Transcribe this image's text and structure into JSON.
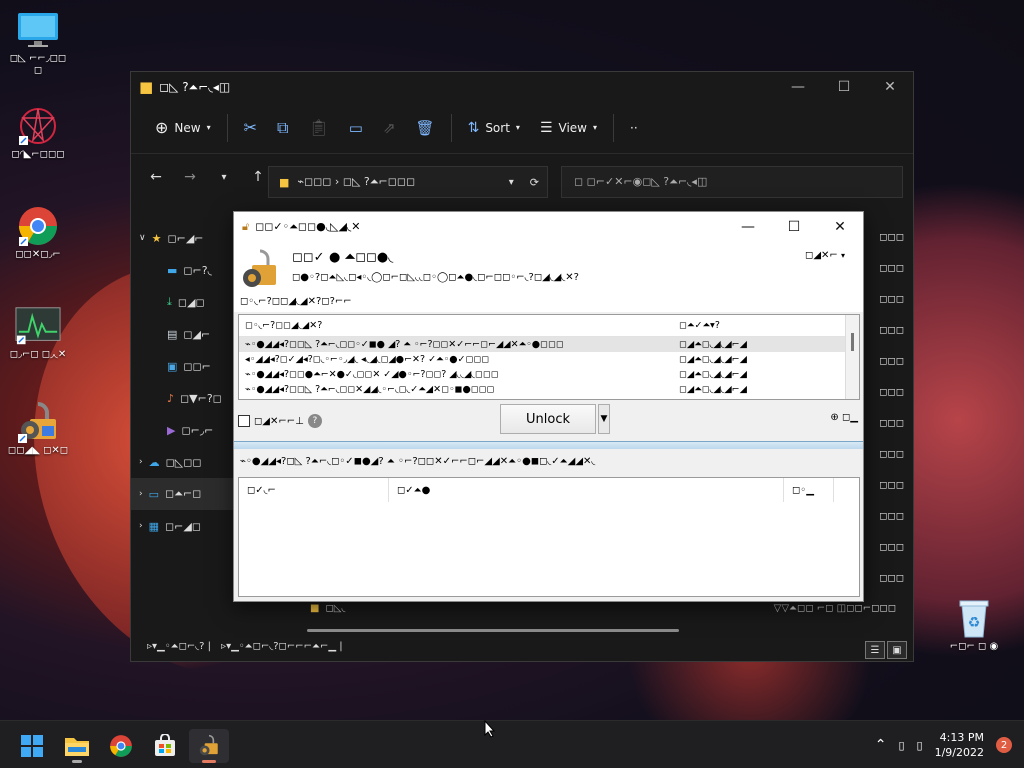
{
  "desktop": {
    "icons": [
      {
        "label": "◻◺ ⌐⌐◞◻◻◻"
      },
      {
        "label": "◻◜◣⌐◻◻◻"
      },
      {
        "label": "◻◻✕◻◞⌐"
      },
      {
        "label": "◻◞⌐◻ ◻◞◟✕"
      },
      {
        "label": "◻◻◢◣ ◻✕◻"
      },
      {
        "label": "⌐◻⌐ ◻ ◉"
      }
    ]
  },
  "explorer": {
    "title": "◻◺ ?⏶⌐◟◂◫",
    "toolbar": {
      "new_label": "New",
      "sort_label": "Sort",
      "view_label": "View",
      "more_label": "··"
    },
    "address": "⌁◻◻◻ › ◻◺ ?⏶⌐◻◻◻",
    "search_placeholder": "◻ ◻⌐✓✕⌐◉◻◺ ?⏶⌐◟◂◫",
    "nav_items": [
      "◻⌐◢⌐",
      "◻⌐?◟",
      "◻◢◻",
      "◻◢⌐",
      "◻◻⌐",
      "◻▼⌐?◻",
      "◻⌐◞⌐",
      "◻◺◻◻",
      "◻⏶⌐◻",
      "◻⌐◢◻"
    ],
    "right_col": [
      "◻◻◻",
      "◻◻◻",
      "◻◻◻",
      "◻◻◻",
      "◻◻◻",
      "◻◻◻",
      "◻◻◻",
      "◻◻◻",
      "◻◻◻",
      "◻◻◻",
      "◻◻◻",
      "◻◻◻"
    ],
    "folder_row": {
      "name": "◻◺◟",
      "info": "▽▽⏶◻◻ ⌐◻ ◫◻◻⌐◻◻◻"
    },
    "status_left": "▹▾▁◦⏶◻⌐◟? |",
    "status_right": "▹▾▁◦⏶◻⌐◟?◻⌐⌐⌐⏶⌐▁ |"
  },
  "dialog": {
    "title": "◻◻✓◦⏶◻◻●◟◺◢◟✕",
    "app_name": "◻◻✓ ● ⏶◻◻●◟",
    "app_subtitle": "◻●◦?◻⏶◺◟◻◂◦◟◯◻⌐◻◺◟◟◻◦◯◻⏶●◟◻⌐◻◻◦⌐◟?◻◢◟◢◟✕?",
    "language": "◻◢✕⌐",
    "hint": "◻◦◟⌐?◻◻◢◟◢✕?◻?⌐⌐",
    "list_header": {
      "col1": "◻◦◟⌐?◻◻◢◟◢✕?",
      "col2": "◻⏶✓⏶▾?"
    },
    "list_rows": [
      {
        "path": "⌁◦●◢◢◂?◻◻◺ ?⏶⌐◟◻◻◦✓◼● ◢? ⏶ ◦⌐?◻◻✕✓⌐⌐◻⌐◢◢✕⏶◦●◻◻◻",
        "status": "◻◢⏶◻◟◢◟◢⌐◢"
      },
      {
        "path": "◂◦◢◢◂?◻✓◢◂?◻◟◦⌐◦◞◢◟ ◂◟◢◟◻◢●⌐✕? ✓⏶◦●✓◻◻◻",
        "status": "◻◢⏶◻◟◢◟◢⌐◢"
      },
      {
        "path": "⌁◦●◢◢◂?◻◻●⏶⌐✕●✓◟◻◻✕ ✓◢●◦⌐?◻◻? ◢◟◟◢◟◻◻◻",
        "status": "◻◢⏶◻◟◢◟◢⌐◢"
      },
      {
        "path": "⌁◦●◢◢◂?◻◻◺ ?⏶⌐◟◻◻✕◢◢◟◦⌐◟◻◟✓⏶◢✕◻◦◼●◻◻◻",
        "status": "◻◢⏶◻◟◢◟◢⌐◢"
      }
    ],
    "checkbox_label": "◻◢✕⌐⌐⊥",
    "unlock_label": "Unlock",
    "right_label": "◻▁",
    "lower_title": "⌁◦●◢◢◂?◻◺ ?⏶⌐◟◻◦✓◼●◢? ⏶ ◦⌐?◻◻✕✓⌐⌐◻⌐◢◢✕⏶◦●◼◻◟✓⏶◢◢✕◟",
    "table_header": {
      "col1": "◻✓◟⌐",
      "col2": "◻✓⏶●",
      "col3": "◻◦▁"
    }
  },
  "taskbar": {
    "time": "4:13 PM",
    "date": "1/9/2022",
    "notification_count": "2"
  },
  "colors": {
    "accent": "#e27b60",
    "taskbar_bg": "#1f1f22",
    "explorer_bg": "#191919"
  }
}
